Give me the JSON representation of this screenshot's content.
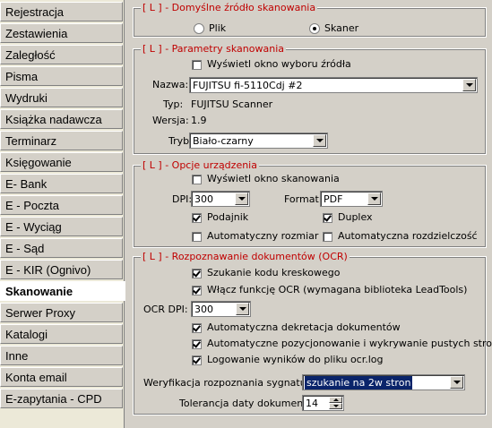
{
  "sidebar": {
    "items": [
      {
        "label": "Rejestracja"
      },
      {
        "label": "Zestawienia"
      },
      {
        "label": "Zaległość"
      },
      {
        "label": "Pisma"
      },
      {
        "label": "Wydruki"
      },
      {
        "label": "Książka nadawcza"
      },
      {
        "label": "Terminarz"
      },
      {
        "label": "Księgowanie"
      },
      {
        "label": "E- Bank"
      },
      {
        "label": "E - Poczta"
      },
      {
        "label": "E - Wyciąg"
      },
      {
        "label": "E - Sąd"
      },
      {
        "label": "E - KIR (Ognivo)"
      },
      {
        "label": "Skanowanie"
      },
      {
        "label": "Serwer Proxy"
      },
      {
        "label": "Katalogi"
      },
      {
        "label": "Inne"
      },
      {
        "label": "Konta email"
      },
      {
        "label": "E-zapytania - CPD"
      }
    ],
    "active_index": 13
  },
  "source": {
    "legend": "[ L ] - Domyślne źródło skanowania",
    "plik_label": "Plik",
    "skaner_label": "Skaner",
    "selected": "Skaner"
  },
  "params": {
    "legend": "[ L ] - Parametry skanowania",
    "show_source_label": "Wyświetl okno wyboru źródła",
    "show_source_checked": false,
    "nazwa_label": "Nazwa:",
    "nazwa_value": "FUJITSU fi-5110Cdj #2",
    "typ_label": "Typ:",
    "typ_value": "FUJITSU Scanner",
    "wersja_label": "Wersja:",
    "wersja_value": "1.9",
    "tryb_label": "Tryb:",
    "tryb_value": "Biało-czarny"
  },
  "device": {
    "legend": "[ L ] - Opcje urządzenia",
    "show_scan_label": "Wyświetl okno skanowania",
    "show_scan_checked": false,
    "dpi_label": "DPI:",
    "dpi_value": "300",
    "format_label": "Format:",
    "format_value": "PDF",
    "podajnik_label": "Podajnik",
    "podajnik_checked": true,
    "duplex_label": "Duplex",
    "duplex_checked": true,
    "auto_size_label": "Automatyczny rozmiar",
    "auto_size_checked": false,
    "auto_res_label": "Automatyczna rozdzielczość",
    "auto_res_checked": false
  },
  "ocr": {
    "legend": "[ L ] - Rozpoznawanie dokumentów (OCR)",
    "barcode_label": "Szukanie kodu kreskowego",
    "barcode_checked": true,
    "ocr_enable_label": "Włącz funkcję OCR (wymagana biblioteka LeadTools)",
    "ocr_enable_checked": true,
    "ocr_dpi_label": "OCR DPI:",
    "ocr_dpi_value": "300",
    "auto_decr_label": "Automatyczna dekretacja dokumentów",
    "auto_decr_checked": true,
    "auto_pos_label": "Automatyczne pozycjonowanie i wykrywanie pustych stron",
    "auto_pos_checked": true,
    "log_label": "Logowanie wyników do pliku ocr.log",
    "log_checked": true,
    "verify_label": "Weryfikacja rozpoznania sygnatury:",
    "verify_value": "szukanie na 2w stron",
    "tolerance_label": "Tolerancja daty dokumentu:",
    "tolerance_value": "14"
  }
}
